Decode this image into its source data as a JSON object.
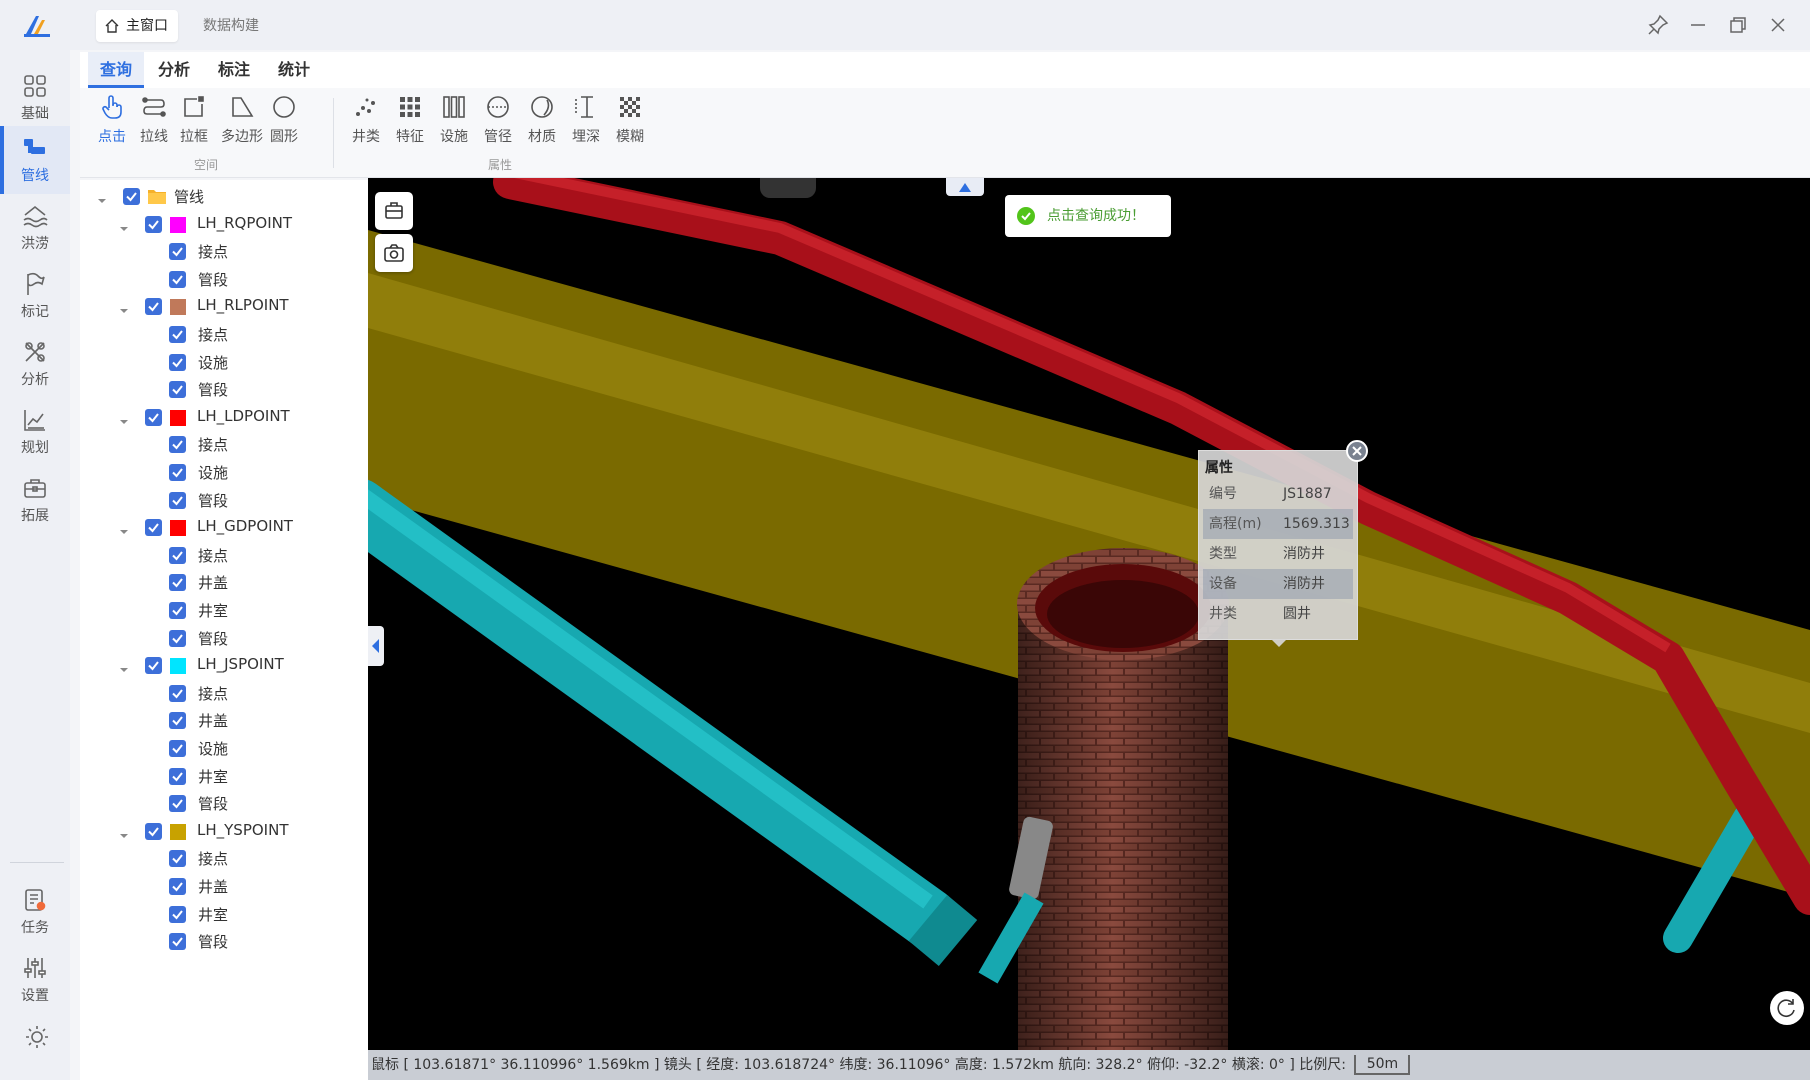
{
  "rail": {
    "items": [
      {
        "label": "基础"
      },
      {
        "label": "管线"
      },
      {
        "label": "洪涝"
      },
      {
        "label": "标记"
      },
      {
        "label": "分析"
      },
      {
        "label": "规划"
      },
      {
        "label": "拓展"
      }
    ],
    "bottom": [
      {
        "label": "任务"
      },
      {
        "label": "设置"
      }
    ]
  },
  "titlebar": {
    "main_tab": "主窗口",
    "secondary_tab": "数据构建"
  },
  "menu": {
    "tabs": [
      "查询",
      "分析",
      "标注",
      "统计"
    ]
  },
  "toolbar": {
    "space_tools": [
      "点击",
      "拉线",
      "拉框",
      "多边形",
      "圆形"
    ],
    "space_group": "空间",
    "attr_tools": [
      "井类",
      "特征",
      "设施",
      "管径",
      "材质",
      "埋深",
      "模糊"
    ],
    "attr_group": "属性"
  },
  "tree": {
    "root": "管线",
    "layers": [
      {
        "name": "LH_RQPOINT",
        "color": "#ff00ff",
        "children": [
          "接点",
          "管段"
        ]
      },
      {
        "name": "LH_RLPOINT",
        "color": "#c0795a",
        "children": [
          "接点",
          "设施",
          "管段"
        ]
      },
      {
        "name": "LH_LDPOINT",
        "color": "#ff0000",
        "children": [
          "接点",
          "设施",
          "管段"
        ]
      },
      {
        "name": "LH_GDPOINT",
        "color": "#ff0000",
        "children": [
          "接点",
          "井盖",
          "井室",
          "管段"
        ]
      },
      {
        "name": "LH_JSPOINT",
        "color": "#00e5ff",
        "children": [
          "接点",
          "井盖",
          "设施",
          "井室",
          "管段"
        ]
      },
      {
        "name": "LH_YSPOINT",
        "color": "#c8a200",
        "children": [
          "接点",
          "井盖",
          "井室",
          "管段"
        ]
      }
    ]
  },
  "toast": {
    "message": "点击查询成功！"
  },
  "popup": {
    "title": "属性",
    "rows": [
      {
        "key": "编号",
        "value": "JS1887"
      },
      {
        "key": "高程(m)",
        "value": "1569.313"
      },
      {
        "key": "类型",
        "value": "消防井"
      },
      {
        "key": "设备",
        "value": "消防井"
      },
      {
        "key": "井类",
        "value": "圆井"
      }
    ]
  },
  "status": {
    "text": "鼠标 [ 103.61871° 36.110996° 1.569km ] 镜头 [ 经度: 103.618724° 纬度: 36.11096° 高度: 1.572km 航向: 328.2° 俯仰: -32.2° 横滚: 0° ] 比例尺:",
    "scale": "50m"
  }
}
